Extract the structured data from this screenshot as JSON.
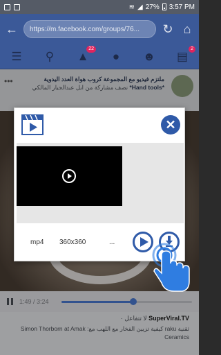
{
  "status_bar": {
    "battery": "27%",
    "time": "3:57 PM"
  },
  "browser": {
    "url": "https://m.facebook.com/groups/76..."
  },
  "fb_nav": {
    "notifications_badge": "22",
    "requests_badge": "2"
  },
  "feed": {
    "post_text_bold": "ملتزم فيديو مع المجموعة كروب هواة العدد اليدوية *Hand tools*",
    "post_text_plain": "نصف مشاركة  من ابل عبدالجبار المالكي",
    "player_time": "1:49 / 3:24",
    "player_progress": 0.55,
    "bottom_channel": "SuperViral.TV",
    "bottom_meta": "لا تتفاعل ·",
    "bottom_desc": "ثقنية raku كيفية تزيين الفخار مع اللهب مع: Simon Thorborn at Amak Ceramics"
  },
  "dialog": {
    "format": "mp4",
    "resolution": "360x360",
    "more": "..."
  },
  "colors": {
    "facebook_blue": "#3b5998",
    "accent_blue": "#2f5aa8"
  },
  "icons": {
    "back": "arrow-left-icon",
    "reload": "reload-icon",
    "home": "home-icon",
    "close": "close-icon",
    "download": "download-icon",
    "play": "play-icon",
    "tap": "hand-pointer-icon"
  }
}
